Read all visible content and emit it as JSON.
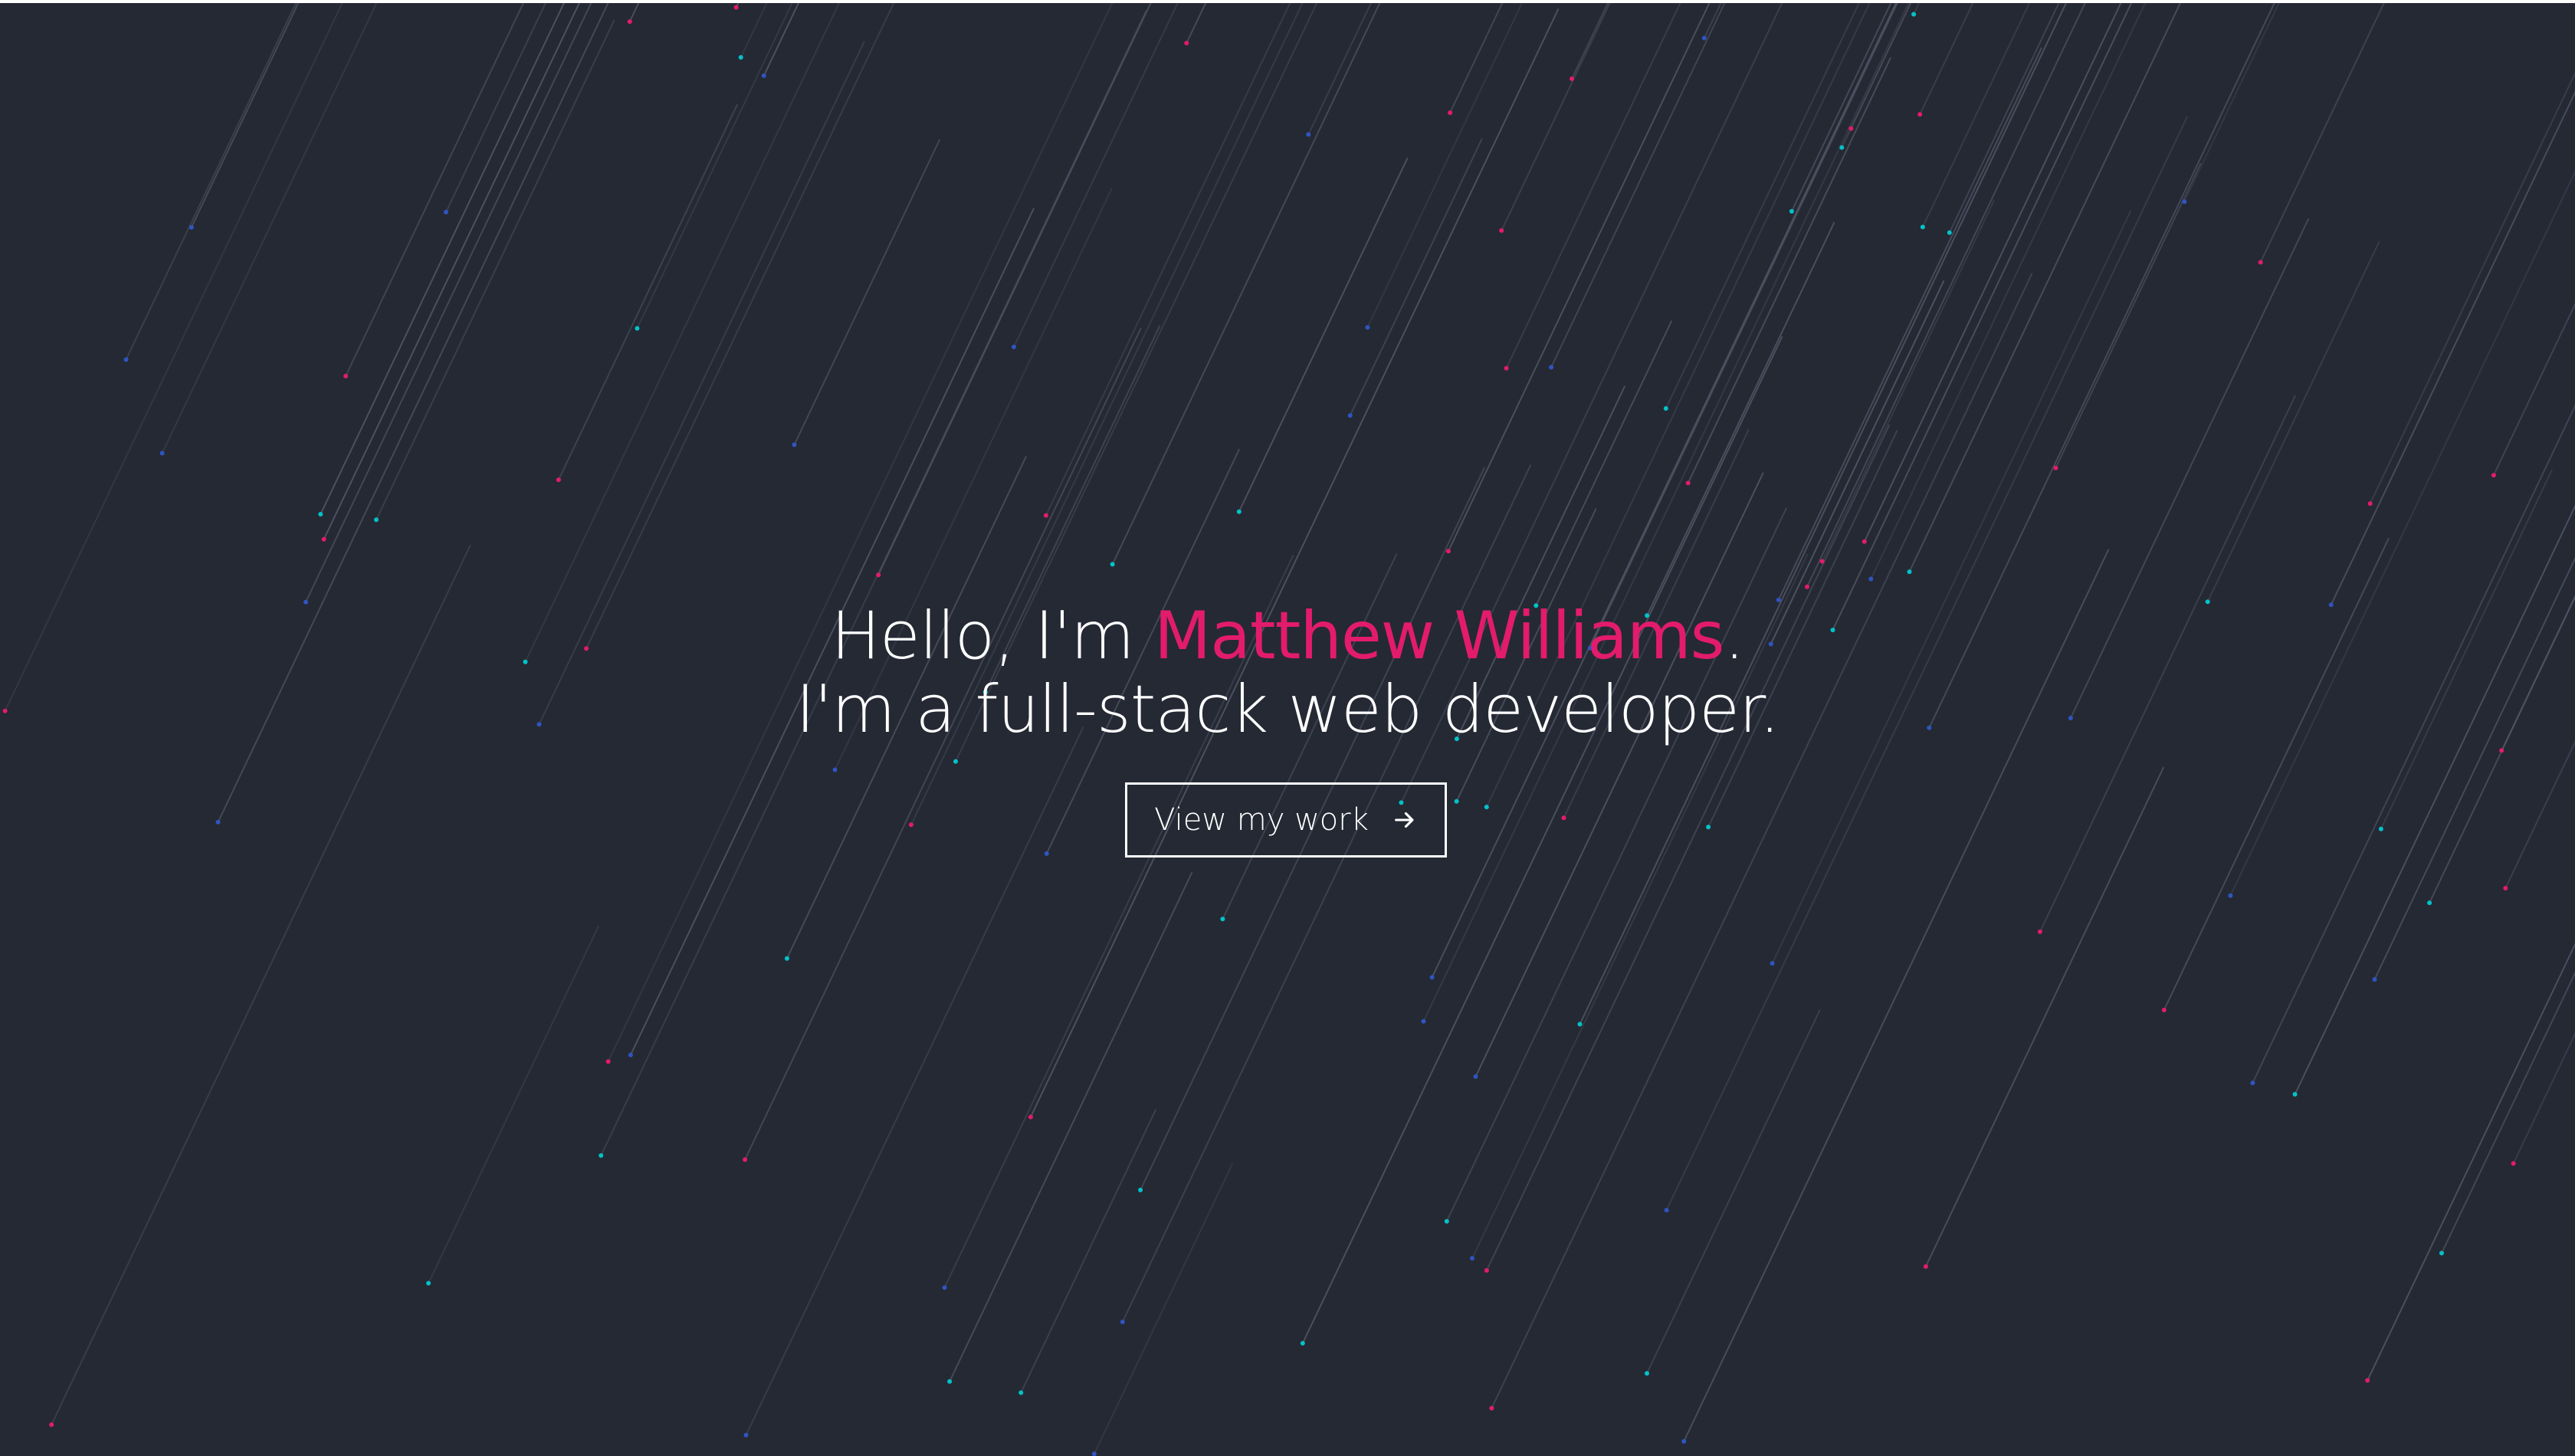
{
  "hero": {
    "greeting_prefix": "Hello, I'm ",
    "name": "Matthew Williams",
    "greeting_suffix": ".",
    "tagline": "I'm a full-stack web developer.",
    "cta_label": "View my work",
    "cta_icon": "arrow-right-icon"
  },
  "colors": {
    "background": "#252934",
    "accent": "#e31b6d",
    "text": "#ffffff",
    "particle_colors": [
      "#e31b6d",
      "#04c2c9",
      "#2e55c1"
    ]
  }
}
